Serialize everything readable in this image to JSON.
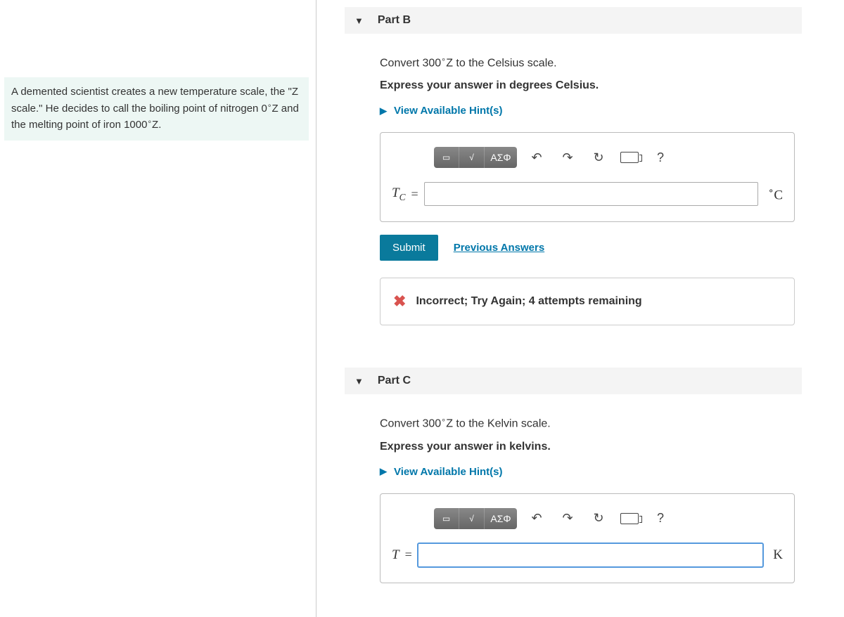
{
  "problem": {
    "text_prefix": "A demented scientist creates a new temperature scale, the \"Z scale.\" He decides to call the boiling point of nitrogen ",
    "bp_value": "0",
    "bp_unit_deg": "∘",
    "bp_unit_letter": "Z",
    "text_mid": " and the melting point of iron ",
    "mp_value": "1000",
    "mp_unit_deg": "∘",
    "mp_unit_letter": "Z",
    "text_suffix": "."
  },
  "partB": {
    "header": "Part B",
    "question_prefix": "Convert ",
    "question_value": "300",
    "question_deg": "∘",
    "question_letter": "Z",
    "question_suffix": " to the Celsius scale.",
    "instruction": "Express your answer in degrees Celsius.",
    "hints_label": "View Available Hint(s)",
    "toolbar_greek": "ΑΣΦ",
    "var": "T",
    "var_sub": "C",
    "eq": "=",
    "unit_deg": "∘",
    "unit_letter": "C",
    "submit": "Submit",
    "prev": "Previous Answers",
    "feedback": "Incorrect; Try Again; 4 attempts remaining",
    "input_value": ""
  },
  "partC": {
    "header": "Part C",
    "question_prefix": "Convert ",
    "question_value": "300",
    "question_deg": "∘",
    "question_letter": "Z",
    "question_suffix": " to the Kelvin scale.",
    "instruction": "Express your answer in kelvins.",
    "hints_label": "View Available Hint(s)",
    "toolbar_greek": "ΑΣΦ",
    "var": "T",
    "eq": "=",
    "unit": "K",
    "input_value": ""
  },
  "help_symbol": "?"
}
